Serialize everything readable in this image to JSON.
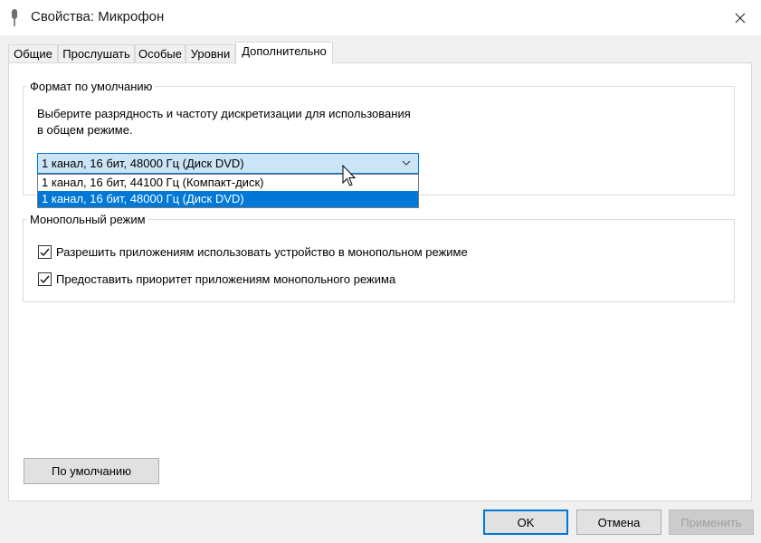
{
  "window": {
    "title": "Свойства: Микрофон"
  },
  "tabs": [
    {
      "label": "Общие"
    },
    {
      "label": "Прослушать"
    },
    {
      "label": "Особые"
    },
    {
      "label": "Уровни"
    },
    {
      "label": "Дополнительно"
    }
  ],
  "default_format": {
    "group_title": "Формат по умолчанию",
    "description_line1": "Выберите разрядность и частоту дискретизации для использования",
    "description_line2": "в общем режиме.",
    "selected_value": "1 канал, 16 бит, 48000 Гц (Диск DVD)",
    "options": [
      "1 канал, 16 бит, 44100 Гц (Компакт-диск)",
      "1 канал, 16 бит, 48000 Гц (Диск DVD)"
    ]
  },
  "exclusive_mode": {
    "group_title": "Монопольный режим",
    "allow_exclusive": {
      "label": "Разрешить приложениям использовать устройство в монопольном режиме",
      "checked": true
    },
    "give_priority": {
      "label": "Предоставить приоритет приложениям монопольного режима",
      "checked": true
    }
  },
  "buttons": {
    "restore_defaults": "По умолчанию",
    "ok": "OK",
    "cancel": "Отмена",
    "apply": "Применить"
  },
  "colors": {
    "accent": "#0078d7",
    "selection_bg": "#cce4f7"
  }
}
